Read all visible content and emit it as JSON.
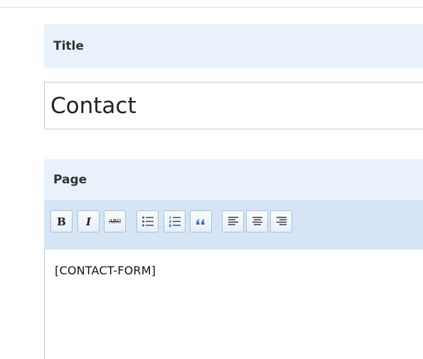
{
  "form": {
    "title_label": "Title",
    "title_value": "Contact",
    "page_label": "Page",
    "page_content": "[CONTACT-FORM]"
  },
  "toolbar": {
    "buttons": [
      {
        "name": "bold-button",
        "icon": "bold-icon",
        "label": "B"
      },
      {
        "name": "italic-button",
        "icon": "italic-icon",
        "label": "I"
      },
      {
        "name": "strikethrough-button",
        "icon": "strikethrough-icon",
        "label": "ABC"
      },
      {
        "name": "bullet-list-button",
        "icon": "bullet-list-icon"
      },
      {
        "name": "numbered-list-button",
        "icon": "numbered-list-icon"
      },
      {
        "name": "blockquote-button",
        "icon": "blockquote-icon"
      },
      {
        "name": "align-left-button",
        "icon": "align-left-icon"
      },
      {
        "name": "align-center-button",
        "icon": "align-center-icon"
      },
      {
        "name": "align-right-button",
        "icon": "align-right-icon"
      }
    ],
    "colors": {
      "bar": "#d6e5f5",
      "button_border": "#a7c1de",
      "header_bg": "#e9f1fb"
    }
  }
}
